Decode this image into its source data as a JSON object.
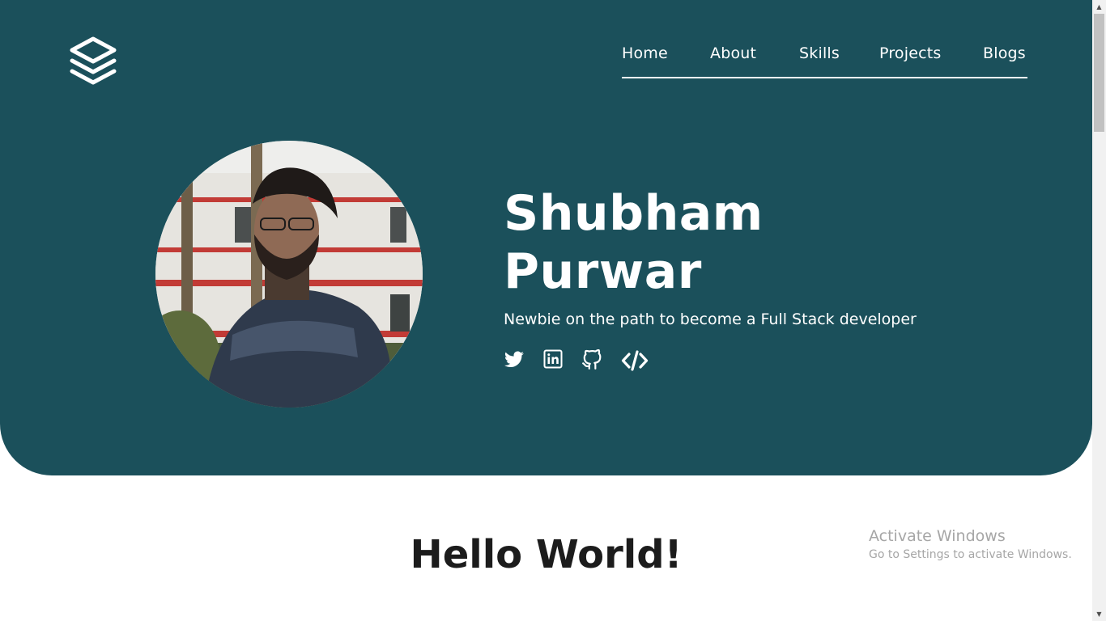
{
  "colors": {
    "hero_background": "#1b505b",
    "hero_text": "#ffffff",
    "heading_text": "#1c1c1c",
    "watermark_text": "#a6a6a6"
  },
  "header": {
    "logo_icon": "stacked-layers-icon",
    "nav": [
      {
        "label": "Home"
      },
      {
        "label": "About"
      },
      {
        "label": "Skills"
      },
      {
        "label": "Projects"
      },
      {
        "label": "Blogs"
      }
    ]
  },
  "hero": {
    "name_first": "Shubham",
    "name_last": "Purwar",
    "tagline": "Newbie on the path to become a Full Stack developer",
    "socials": [
      {
        "icon": "twitter-icon"
      },
      {
        "icon": "linkedin-icon"
      },
      {
        "icon": "github-icon"
      },
      {
        "icon": "code-icon"
      }
    ]
  },
  "main": {
    "heading": "Hello World!"
  },
  "watermark": {
    "title": "Activate Windows",
    "subtitle": "Go to Settings to activate Windows."
  }
}
